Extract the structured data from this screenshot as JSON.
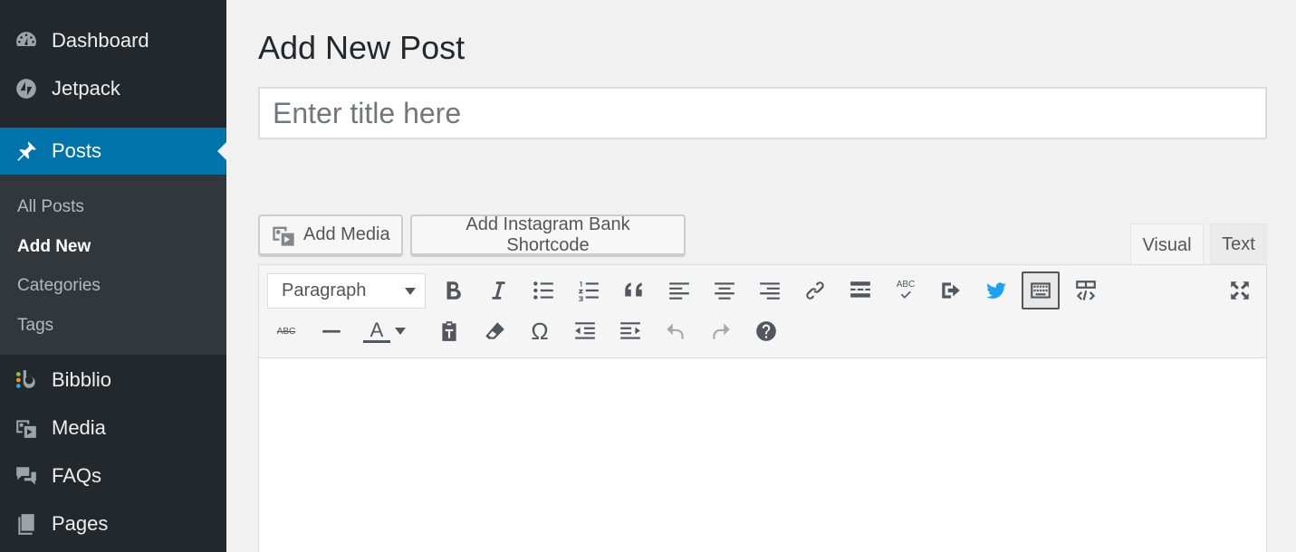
{
  "sidebar": {
    "items": [
      {
        "label": "Dashboard",
        "icon": "dashboard-icon"
      },
      {
        "label": "Jetpack",
        "icon": "jetpack-icon"
      },
      {
        "label": "Posts",
        "icon": "pin-icon",
        "active": true
      },
      {
        "label": "Bibblio",
        "icon": "bibblio-icon"
      },
      {
        "label": "Media",
        "icon": "media-icon"
      },
      {
        "label": "FAQs",
        "icon": "comments-icon"
      },
      {
        "label": "Pages",
        "icon": "pages-icon"
      }
    ],
    "submenu": [
      "All Posts",
      "Add New",
      "Categories",
      "Tags"
    ],
    "current_sub": "Add New",
    "colors": {
      "bg": "#23282d",
      "active": "#0073aa",
      "submenu_bg": "#32373c"
    }
  },
  "main": {
    "page_title": "Add New Post",
    "title_placeholder": "Enter title here",
    "buttons": {
      "add_media": "Add Media",
      "add_instagram": "Add Instagram Bank Shortcode"
    },
    "tabs": {
      "visual": "Visual",
      "text": "Text"
    },
    "format_select": "Paragraph",
    "toolbar_row1": [
      "bold-icon",
      "italic-icon",
      "bullet-list-icon",
      "numbered-list-icon",
      "blockquote-icon",
      "align-left-icon",
      "align-center-icon",
      "align-right-icon",
      "link-icon",
      "read-more-icon",
      "spellcheck-icon",
      "share-icon",
      "twitter-icon",
      "toolbar-toggle-icon",
      "embed-code-icon",
      "fullscreen-icon"
    ],
    "toolbar_row2": [
      "strikethrough-icon",
      "horizontal-rule-icon",
      "text-color-icon",
      "paste-text-icon",
      "clear-formatting-icon",
      "special-character-icon",
      "outdent-icon",
      "indent-icon",
      "undo-icon",
      "redo-icon",
      "help-icon"
    ],
    "spellcheck_label": "ABC",
    "strikethrough_label": "ABC",
    "text_color_label": "A",
    "special_char_label": "Ω",
    "colors": {
      "twitter": "#1da1f2"
    }
  }
}
